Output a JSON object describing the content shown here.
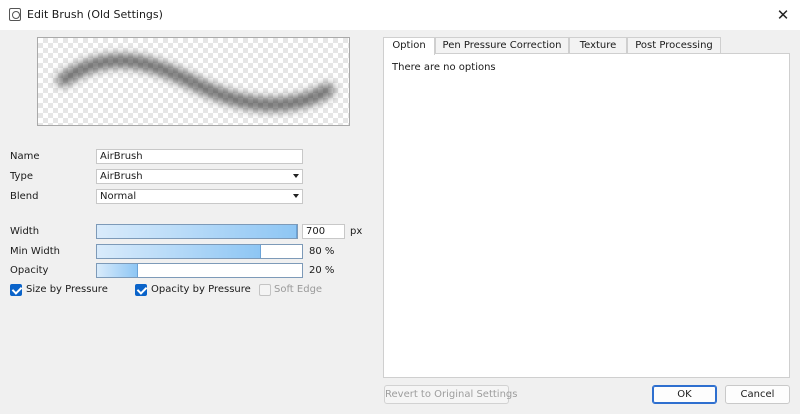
{
  "window": {
    "title": "Edit Brush (Old Settings)",
    "close_glyph": "✕"
  },
  "form": {
    "name": {
      "label": "Name",
      "value": "AirBrush"
    },
    "type": {
      "label": "Type",
      "value": "AirBrush"
    },
    "blend": {
      "label": "Blend",
      "value": "Normal"
    }
  },
  "sliders": {
    "width": {
      "label": "Width",
      "value": "700",
      "unit": "px",
      "fill": 1.0
    },
    "min_width": {
      "label": "Min Width",
      "value": "80",
      "unit": "%",
      "fill": 0.8
    },
    "opacity": {
      "label": "Opacity",
      "value": "20",
      "unit": "%",
      "fill": 0.2
    }
  },
  "checkboxes": {
    "size_by_pressure": {
      "label": "Size by Pressure",
      "checked": true
    },
    "opacity_by_pressure": {
      "label": "Opacity by Pressure",
      "checked": true
    },
    "soft_edge": {
      "label": "Soft Edge",
      "checked": false,
      "disabled": true
    }
  },
  "tabs": [
    "Option",
    "Pen Pressure Correction",
    "Texture",
    "Post Processing"
  ],
  "active_tab": "Option",
  "panel": {
    "message": "There are no options"
  },
  "buttons": {
    "revert": "Revert to Original Settings",
    "ok": "OK",
    "cancel": "Cancel"
  },
  "colors": {
    "accent": "#0a63c9",
    "slider_fill": "#8ec6f4"
  }
}
